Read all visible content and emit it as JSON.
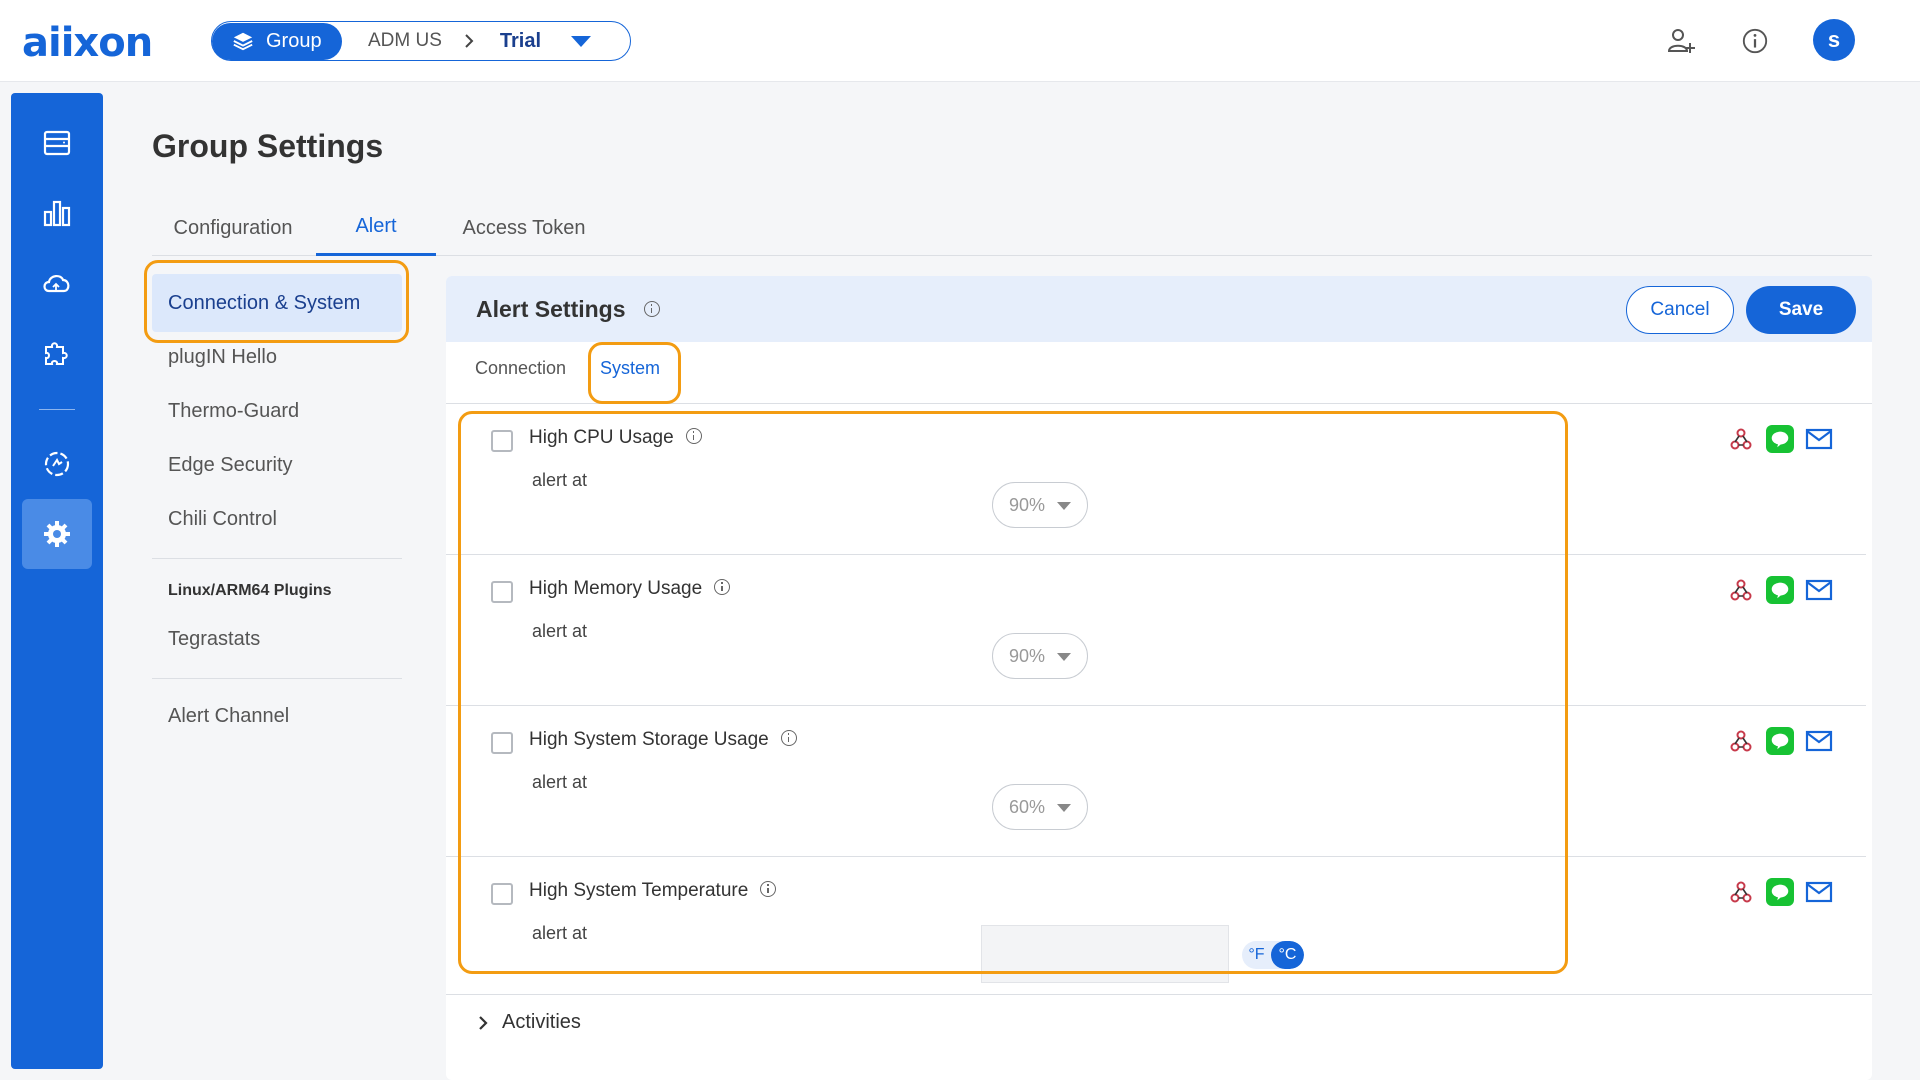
{
  "app": {
    "logo": "aiixon"
  },
  "breadcrumb": {
    "group_label": "Group",
    "org": "ADM US",
    "current": "Trial"
  },
  "topbar": {
    "avatar_initial": "s"
  },
  "page": {
    "title": "Group Settings"
  },
  "tabs": [
    {
      "label": "Configuration"
    },
    {
      "label": "Alert"
    },
    {
      "label": "Access Token"
    }
  ],
  "submenu": {
    "items": [
      "Connection & System",
      "plugIN Hello",
      "Thermo-Guard",
      "Edge Security",
      "Chili Control"
    ],
    "heading": "Linux/ARM64 Plugins",
    "plugin_items": [
      "Tegrastats"
    ],
    "footer_item": "Alert Channel"
  },
  "alert_settings": {
    "title": "Alert Settings",
    "cancel_label": "Cancel",
    "save_label": "Save",
    "subtabs": [
      "Connection",
      "System"
    ],
    "alert_at_label": "alert at",
    "rows": [
      {
        "name": "High CPU Usage",
        "threshold": "90%"
      },
      {
        "name": "High Memory Usage",
        "threshold": "90%"
      },
      {
        "name": "High System Storage Usage",
        "threshold": "60%"
      },
      {
        "name": "High System Temperature",
        "unit_f": "°F",
        "unit_c": "°C"
      }
    ],
    "activities_label": "Activities"
  },
  "colors": {
    "primary": "#1565d8",
    "highlight": "#f39c12",
    "line_green": "#17c233",
    "webhook_red": "#c73a4b"
  }
}
